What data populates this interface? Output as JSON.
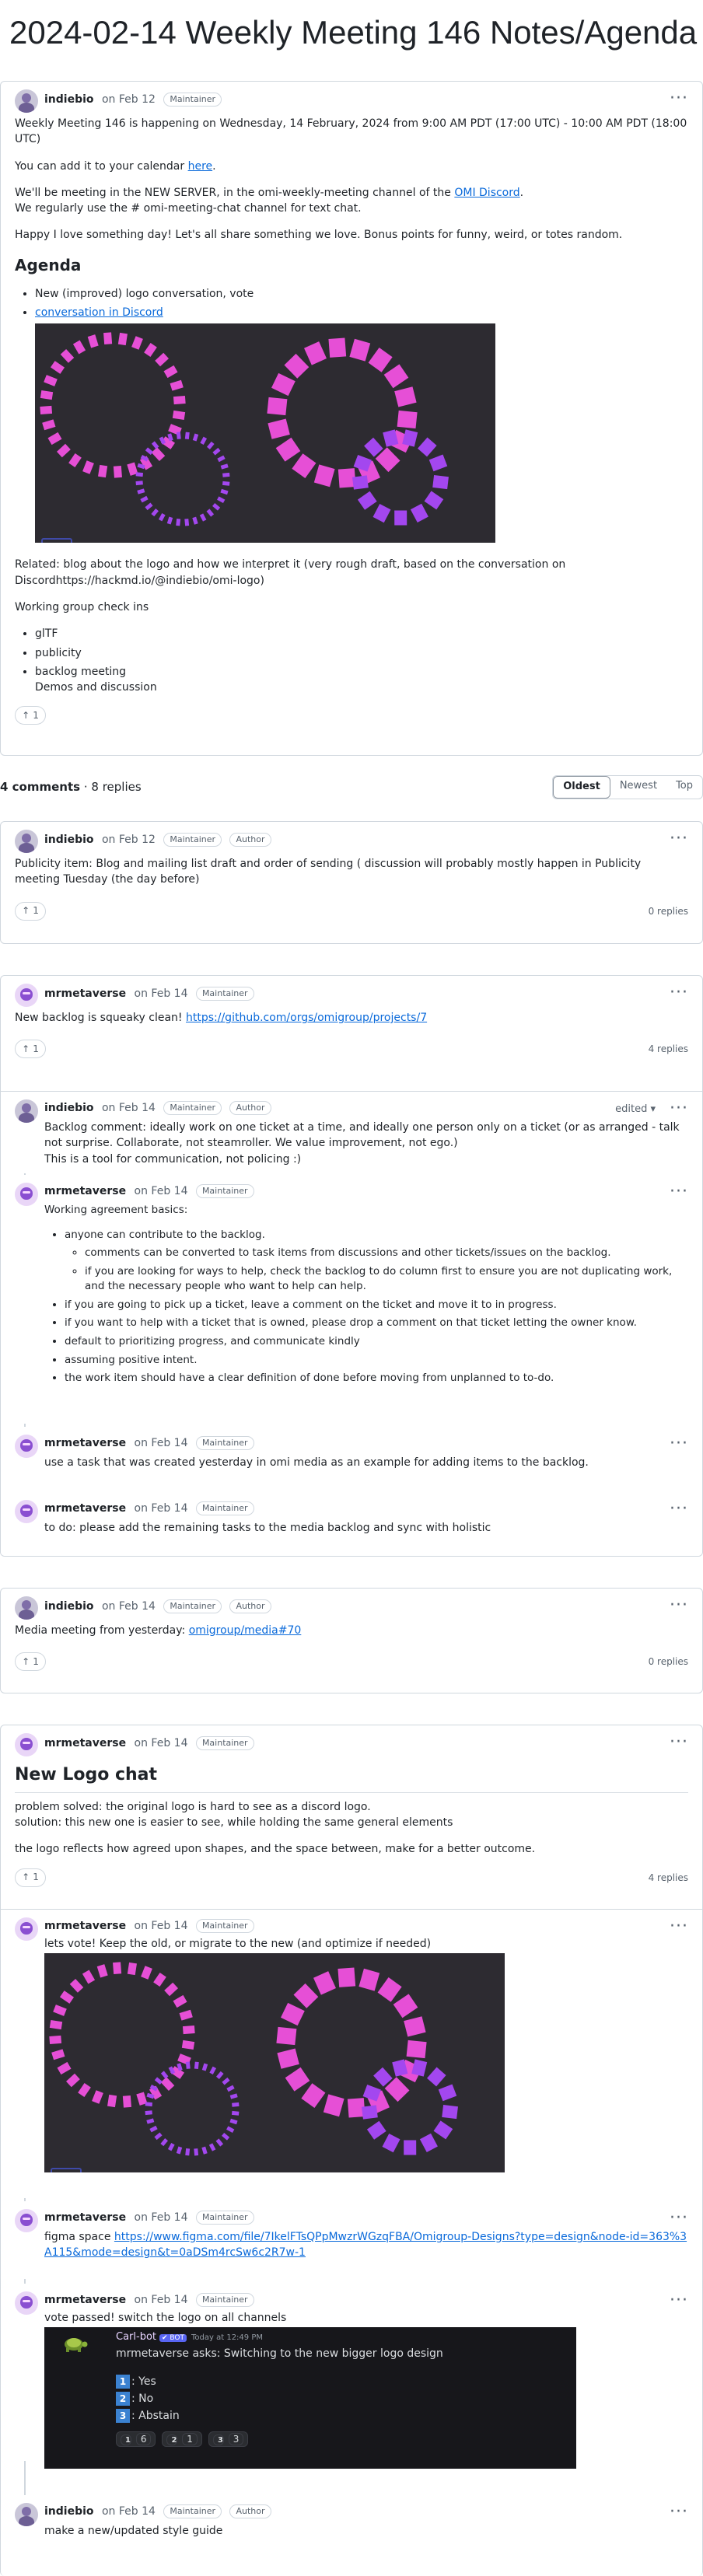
{
  "page_title": "2024-02-14 Weekly Meeting 146 Notes/Agenda",
  "roles": {
    "maintainer": "Maintainer",
    "author": "Author"
  },
  "more_icon": "kebab-horizontal-icon",
  "reaction_icon": "arrow-up-icon",
  "post": {
    "author": "indiebio",
    "date": "on Feb 12",
    "p1": "Weekly Meeting 146 is happening on Wednesday, 14 February, 2024 from 9:00 AM PDT (17:00 UTC) - 10:00 AM PDT (18:00 UTC)",
    "p2_pre": "You can add it to your calendar ",
    "p2_link": "here",
    "p2_post": ".",
    "p3_pre": "We'll be meeting in the NEW SERVER, in the omi-weekly-meeting channel of the ",
    "p3_link": "OMI Discord",
    "p3_post": ".",
    "p3_line2": "We regularly use the # omi-meeting-chat channel for text chat.",
    "p4": "Happy I love something day! Let's all share something we love. Bonus points for funny, weird, or totes random.",
    "agenda_heading": "Agenda",
    "agenda_items": [
      "New (improved) logo conversation, vote",
      "conversation in Discord"
    ],
    "related": "Related: blog about the logo and how we interpret it (very rough draft, based on the conversation on Discordhttps://hackmd.io/@indiebio/omi-logo)",
    "working_group": "Working group check ins",
    "wg_items": [
      "glTF",
      "publicity",
      "backlog meeting",
      "Demos and discussion"
    ],
    "upvotes": "1"
  },
  "comment_summary": {
    "count": "4 comments",
    "replies": "8 replies"
  },
  "sort_options": [
    "Oldest",
    "Newest",
    "Top"
  ],
  "comments": [
    {
      "author": "indiebio",
      "date": "on Feb 12",
      "text": "Publicity item: Blog and mailing list draft and order of sending ( discussion will probably mostly happen in Publicity meeting Tuesday (the day before)",
      "upvotes": "1",
      "replies": "0 replies"
    },
    {
      "author": "mrmetaverse",
      "date": "on Feb 14",
      "text_pre": "New backlog is squeaky clean! ",
      "link": "https://github.com/orgs/omigroup/projects/7",
      "upvotes": "1",
      "replies": "4 replies",
      "thread": [
        {
          "author": "indiebio",
          "date": "on Feb 14",
          "edited": "edited ▾",
          "lines": [
            "Backlog comment: ideally work on one ticket at a time, and ideally one person only on a ticket (or as arranged - talk not surprise. Collaborate, not steamroller. We value improvement, not ego.)",
            "This is a tool for communication, not policing :)"
          ]
        },
        {
          "author": "mrmetaverse",
          "date": "on Feb 14",
          "intro": "Working agreement basics:",
          "bullet1": "anyone can contribute to the backlog.",
          "sub": [
            "comments can be converted to task items from discussions and other tickets/issues on the backlog.",
            "if you are looking for ways to help, check the backlog to do column first to ensure you are not duplicating work, and the necessary people who want to help can help."
          ],
          "bullets": [
            "if you are going to pick up a ticket, leave a comment on the ticket and move it to in progress.",
            "if you want to help with a ticket that is owned, please drop a comment on that ticket letting the owner know.",
            "default to prioritizing progress, and communicate kindly",
            "assuming positive intent.",
            "the work item should have a clear definition of done before moving from unplanned to to-do."
          ]
        },
        {
          "author": "mrmetaverse",
          "date": "on Feb 14",
          "text": "use a task that was created yesterday in omi media as an example for adding items to the backlog."
        },
        {
          "author": "mrmetaverse",
          "date": "on Feb 14",
          "text": "to do: please add the remaining tasks to the media backlog and sync with holistic"
        }
      ]
    },
    {
      "author": "indiebio",
      "date": "on Feb 14",
      "text_pre": "Media meeting from yesterday: ",
      "link": "omigroup/media#70",
      "upvotes": "1",
      "replies": "0 replies"
    },
    {
      "author": "mrmetaverse",
      "date": "on Feb 14",
      "heading": "New Logo chat",
      "l1": "problem solved: the original logo is hard to see as a discord logo.",
      "l2": "solution: this new one is easier to see, while holding the same general elements",
      "l3": "the logo reflects how agreed upon shapes, and the space between, make for a better outcome.",
      "upvotes": "1",
      "replies": "4 replies",
      "thread": [
        {
          "author": "mrmetaverse",
          "date": "on Feb 14",
          "text": "lets vote! Keep the old, or migrate to the new (and optimize if needed)"
        },
        {
          "author": "mrmetaverse",
          "date": "on Feb 14",
          "text_pre": "figma space ",
          "link": "https://www.figma.com/file/7IkelFTsQPpMwzrWGzqFBA/Omigroup-Designs?type=design&node-id=363%3A115&mode=design&t=0aDSm4rcSw6c2R7w-1"
        },
        {
          "author": "mrmetaverse",
          "date": "on Feb 14",
          "text": "vote passed! switch the logo on all channels",
          "poll": {
            "bot_name": "Carl-bot",
            "bot_tag": "✔ BOT",
            "time": "Today at 12:49 PM",
            "question": "mrmetaverse asks: Switching to the new bigger logo design",
            "options": [
              {
                "num": "1",
                "label": ": Yes"
              },
              {
                "num": "2",
                "label": ": No"
              },
              {
                "num": "3",
                "label": ": Abstain"
              }
            ],
            "reactions": [
              {
                "num": "1",
                "count": "6"
              },
              {
                "num": "2",
                "count": "1"
              },
              {
                "num": "3",
                "count": "3"
              }
            ]
          }
        },
        {
          "author": "indiebio",
          "date": "on Feb 14",
          "text": "make a new/updated style guide"
        }
      ]
    }
  ],
  "colors": {
    "link": "#0969da",
    "border": "#d0d7de",
    "logo_bg": "#2d2b31",
    "pink": "#e64fd6",
    "purple": "#a347ef"
  }
}
